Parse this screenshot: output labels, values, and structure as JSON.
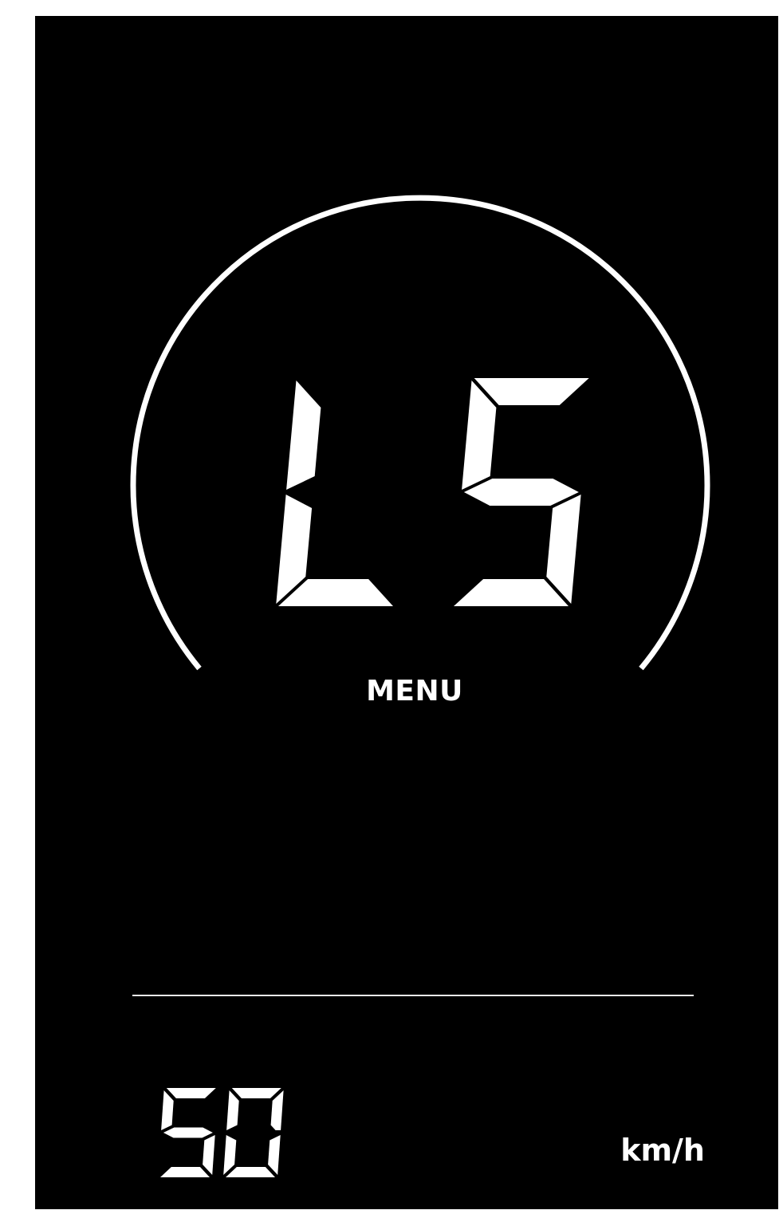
{
  "display": {
    "main_code": "L5",
    "main_label": "MENU",
    "speed_value": "50",
    "speed_unit": "km/h"
  },
  "colors": {
    "background": "#000000",
    "foreground": "#ffffff",
    "frame": "#ffffff"
  }
}
